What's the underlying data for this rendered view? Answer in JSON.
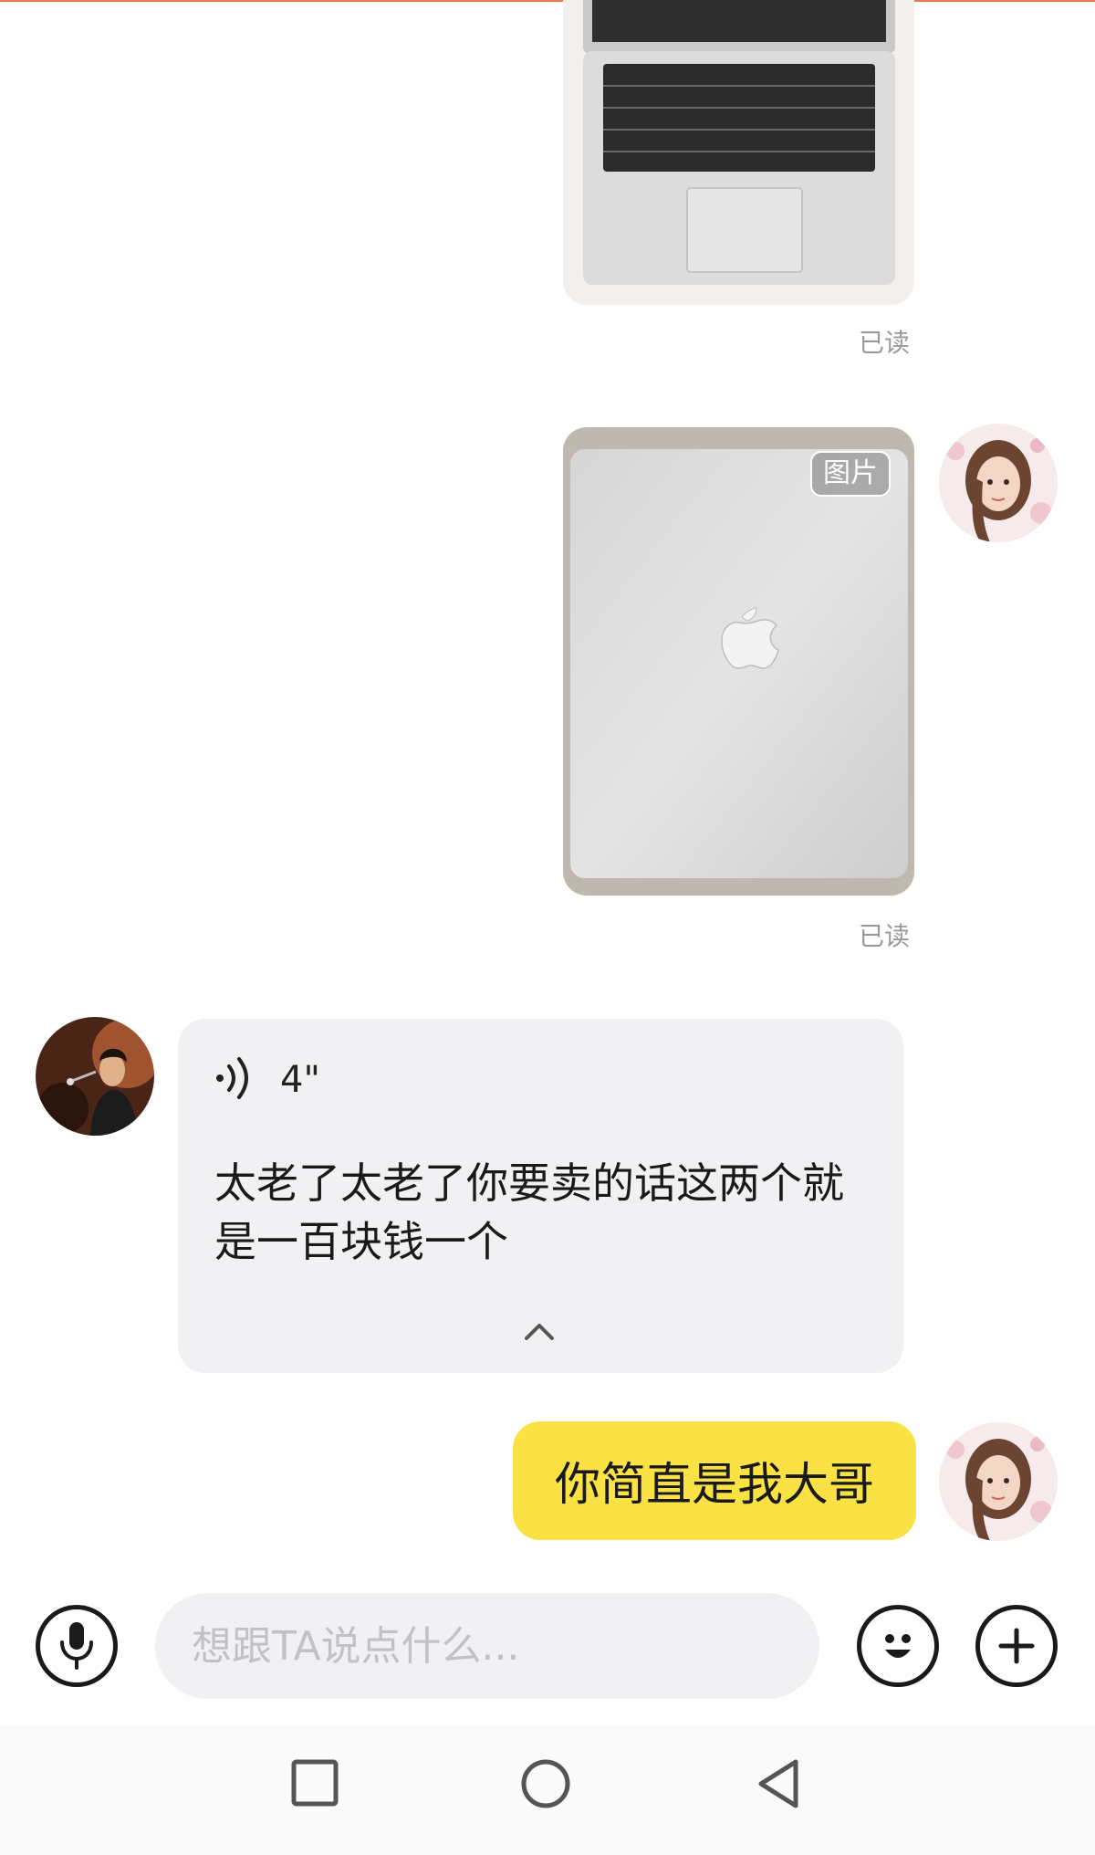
{
  "messages": {
    "image1": {
      "read_status": "已读"
    },
    "image2": {
      "tag": "图片",
      "read_status": "已读"
    },
    "voice": {
      "duration": "4\"",
      "transcript": "太老了太老了你要卖的话这两个就是一百块钱一个"
    },
    "reply": {
      "text": "你简直是我大哥"
    }
  },
  "input_bar": {
    "placeholder": "想跟TA说点什么..."
  },
  "icons": {
    "voice_input": "microphone-icon",
    "emoji": "emoji-icon",
    "more": "plus-icon",
    "playing": "voice-wave-icon",
    "collapse": "chevron-up-icon",
    "nav_recent": "square-icon",
    "nav_home": "circle-icon",
    "nav_back": "triangle-back-icon"
  },
  "colors": {
    "accent_line": "#e8794a",
    "reply_bubble": "#fbe244",
    "incoming_bubble": "#f1f1f3",
    "read_text": "#9a9a9a"
  }
}
